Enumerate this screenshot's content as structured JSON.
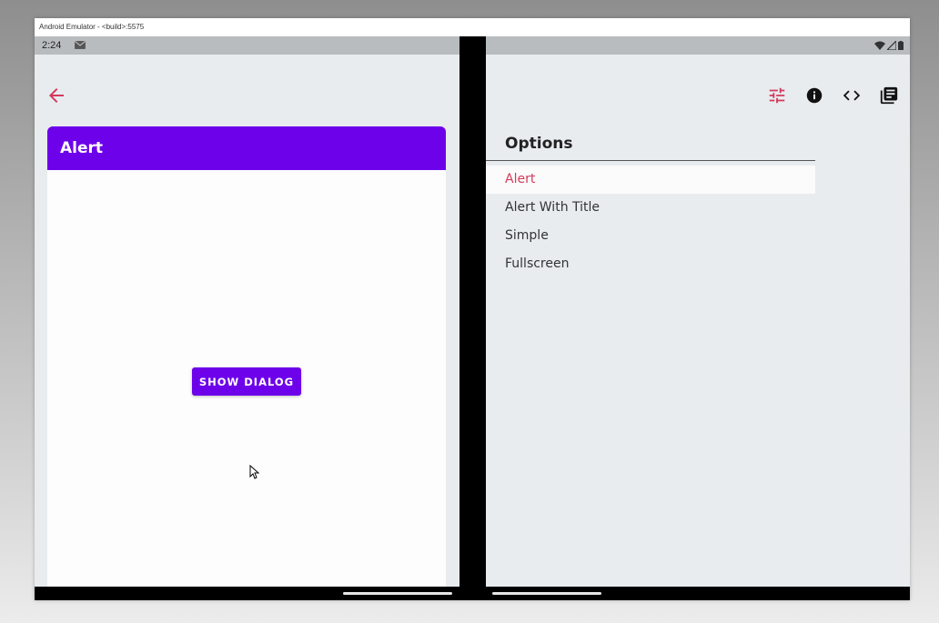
{
  "window": {
    "title": "Android Emulator - <build>:5575"
  },
  "status_bar": {
    "time": "2:24"
  },
  "left_pane": {
    "card_title": "Alert",
    "show_dialog_label": "SHOW DIALOG"
  },
  "right_pane": {
    "options_title": "Options",
    "options": [
      {
        "label": "Alert",
        "selected": true
      },
      {
        "label": "Alert With Title",
        "selected": false
      },
      {
        "label": "Simple",
        "selected": false
      },
      {
        "label": "Fullscreen",
        "selected": false
      }
    ]
  },
  "colors": {
    "accent": "#d4395b",
    "primary": "#6d02ea",
    "background": "#e8ecef"
  },
  "icons": [
    "back-arrow-icon",
    "tune-icon",
    "info-icon",
    "code-icon",
    "library-books-icon"
  ]
}
